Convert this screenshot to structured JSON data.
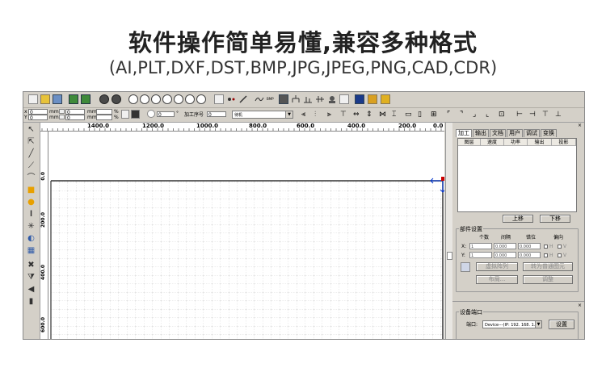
{
  "header": {
    "title": "软件操作简单易懂,兼容多种格式",
    "subtitle": "(AI,PLT,DXF,DST,BMP,JPG,JPEG,PNG,CAD,CDR)"
  },
  "toolbar2": {
    "x_label": "x",
    "y_label": "Y",
    "x_value": "0",
    "y_value": "0",
    "unit_mm": "mm",
    "percent": "%",
    "rotate_value": "0",
    "degree": "°",
    "process_seq_label": "加工序号",
    "process_seq_value": "0",
    "mode_value": "待机"
  },
  "ruler": {
    "top_ticks": [
      "1400.0",
      "1200.0",
      "1000.0",
      "800.0",
      "600.0",
      "400.0",
      "200.0",
      "0.0"
    ],
    "left_ticks": [
      "0.0",
      "200.0",
      "400.0",
      "600.0"
    ]
  },
  "right_panel": {
    "tabs": [
      "加工",
      "输出",
      "文档",
      "用户",
      "调试",
      "变换"
    ],
    "active_tab": "加工",
    "layer_columns": [
      "图层",
      "速度",
      "功率",
      "输出",
      "投影"
    ],
    "move_up": "上移",
    "move_down": "下移",
    "array_group": {
      "title": "部件设置",
      "col_count": "个数",
      "col_spacing": "间隔",
      "col_offset": "错位",
      "col_direction": "偏向",
      "row_x": "X:",
      "row_y": "Y:",
      "x_count": "1",
      "x_spacing": "0.000",
      "x_offset": "0.000",
      "y_count": "1",
      "y_spacing": "0.000",
      "y_offset": "0.000",
      "h_label": "H",
      "v_label": "V",
      "btn_virtual_array": "虚拟阵列",
      "btn_to_normal": "转为普通图元",
      "btn_layout": "布局...",
      "btn_adjust": "调整"
    },
    "device_group": {
      "title": "设备端口",
      "port_label": "端口:",
      "port_value": "Device---(IP: 192. 168. 1. :",
      "settings_button": "设置"
    }
  }
}
